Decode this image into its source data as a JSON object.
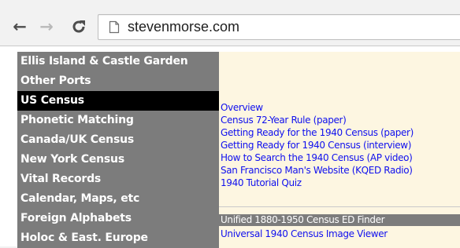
{
  "browser": {
    "back_icon": "back-arrow-icon",
    "forward_icon": "forward-arrow-icon",
    "reload_icon": "reload-icon",
    "page_icon": "page-icon",
    "url": "stevenmorse.com"
  },
  "menu": {
    "background_color": "#7c7c7c",
    "selected_color": "#000000",
    "items": [
      {
        "label": "Ellis Island & Castle Garden"
      },
      {
        "label": "Other Ports"
      },
      {
        "label": "US Census"
      },
      {
        "label": "Phonetic Matching"
      },
      {
        "label": "Canada/UK Census"
      },
      {
        "label": "New York Census"
      },
      {
        "label": "Vital Records"
      },
      {
        "label": "Calendar, Maps, etc"
      },
      {
        "label": "Foreign Alphabets"
      },
      {
        "label": "Holoc & East. Europe"
      }
    ],
    "selected_label": "US Census"
  },
  "submenu": {
    "background_color": "#fdf6e1",
    "link_color": "#1010ee",
    "items": [
      {
        "label": "Overview"
      },
      {
        "label": "Census 72-Year Rule (paper)"
      },
      {
        "label": "Getting Ready for the 1940 Census (paper)"
      },
      {
        "label": "Getting Ready for 1940 Census (interview)"
      },
      {
        "label": "How to Search the 1940 Census (AP video)"
      },
      {
        "label": "San Francisco Man's Website (KQED Radio)"
      },
      {
        "label": "1940 Tutorial Quiz"
      },
      {
        "label": "Unified 1880-1950 Census ED Finder"
      },
      {
        "label": "Universal 1940 Census Image Viewer"
      }
    ],
    "highlighted_label": "Unified 1880-1950 Census ED Finder"
  }
}
